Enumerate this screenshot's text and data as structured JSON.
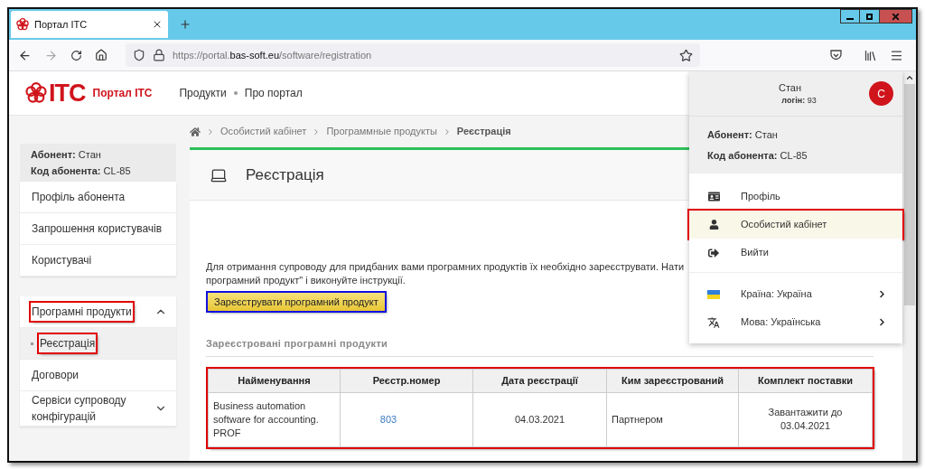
{
  "browser": {
    "tab_title": "Портал ITC",
    "url": {
      "scheme_host": "https://portal.",
      "domain": "bas-soft.eu",
      "path": "/software/registration"
    }
  },
  "header": {
    "logo_text": "ITC",
    "portal_name": "Портал ITC",
    "nav": [
      "Продукти",
      "Про портал"
    ]
  },
  "sidebar": {
    "info": [
      {
        "label": "Абонент:",
        "value": "Стан"
      },
      {
        "label": "Код абонента:",
        "value": "CL-85"
      }
    ],
    "groups": [
      {
        "items": [
          {
            "label": "Профіль абонента",
            "selected": false
          },
          {
            "label": "Запрошення користувачів",
            "selected": false
          },
          {
            "label": "Користувачі",
            "selected": false
          }
        ]
      },
      {
        "items": [
          {
            "label": "Програмні продукти",
            "selected": false,
            "expanded": true,
            "highlighted": true,
            "children": [
              {
                "label": "Реєстрація",
                "selected": true,
                "highlighted": true
              }
            ]
          },
          {
            "label": "Договори",
            "selected": false
          },
          {
            "label": "Сервіси супроводу конфігурацій",
            "selected": false,
            "expanded": false
          }
        ]
      }
    ]
  },
  "breadcrumb": [
    "Особистий кабінет",
    "Программные продукты",
    "Реєстрація"
  ],
  "page": {
    "title": "Реєстрація",
    "intro_lines": [
      "Для отримання супроводу для придбаних вами програмних продуктів їх необхідно зареєструвати. Нати",
      "програмний продукт\" і виконуйте інструкції."
    ],
    "register_button": {
      "label": "Зареєструвати програмний продукт",
      "highlighted": true
    },
    "section_title": "Зареєстровані програмні продукти",
    "table": {
      "highlighted": true,
      "columns": [
        "Найменування",
        "Реєстр.номер",
        "Дата реєстрації",
        "Ким зареєстрований",
        "Комплект поставки"
      ],
      "rows": [
        [
          "Business automation software for accounting. PROF",
          "803",
          "04.03.2021",
          "Партнером",
          "Завантажити до 03.04.2021"
        ]
      ]
    }
  },
  "user_menu": {
    "name": "Стан",
    "login_label": "логін:",
    "login_value": "93",
    "avatar_letter": "С",
    "info": [
      {
        "label": "Абонент:",
        "value": "Стан"
      },
      {
        "label": "Код абонента:",
        "value": "CL-85"
      }
    ],
    "items": [
      {
        "kind": "profile",
        "label": "Профіль",
        "selected": false,
        "highlighted": false
      },
      {
        "kind": "cabinet",
        "label": "Особистий кабінет",
        "selected": true,
        "highlighted": true
      },
      {
        "kind": "logout",
        "label": "Вийти",
        "selected": false,
        "highlighted": false
      }
    ],
    "settings": [
      {
        "kind": "country",
        "label": "Країна: Україна"
      },
      {
        "kind": "language",
        "label": "Мова: Українська"
      }
    ]
  }
}
